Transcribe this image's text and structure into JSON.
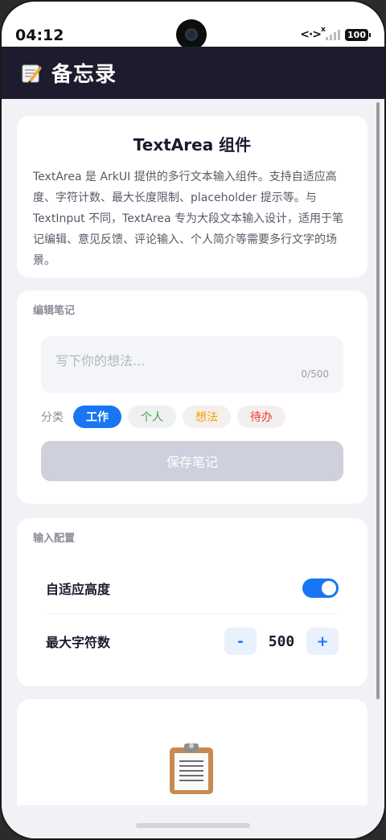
{
  "status_bar": {
    "time": "04:12",
    "network_icon": "data-transfer-icon",
    "signal_icon": "signal-icon",
    "battery": "100"
  },
  "header": {
    "icon": "memo-icon",
    "title": "备忘录"
  },
  "intro": {
    "title": "TextArea 组件",
    "description": "TextArea 是 ArkUI 提供的多行文本输入组件。支持自适应高度、字符计数、最大长度限制、placeholder 提示等。与 TextInput 不同，TextArea 专为大段文本输入设计，适用于笔记编辑、意见反馈、评论输入、个人简介等需要多行文字的场景。"
  },
  "editor": {
    "section_title": "编辑笔记",
    "placeholder": "写下你的想法...",
    "counter": "0/500",
    "category_label": "分类",
    "categories": [
      {
        "label": "工作",
        "selected": true,
        "color": "#1976F2"
      },
      {
        "label": "个人",
        "selected": false,
        "color": "#43A047"
      },
      {
        "label": "想法",
        "selected": false,
        "color": "#F59E0B"
      },
      {
        "label": "待办",
        "selected": false,
        "color": "#E53935"
      }
    ],
    "save_label": "保存笔记"
  },
  "config": {
    "section_title": "输入配置",
    "auto_height_label": "自适应高度",
    "auto_height_on": true,
    "max_chars_label": "最大字符数",
    "decrement_label": "-",
    "max_chars_value": "500",
    "increment_label": "+"
  },
  "empty_state": {
    "icon": "clipboard-icon"
  },
  "colors": {
    "header_bg": "#1C1C2E",
    "accent": "#1976F2",
    "save_disabled": "#CFD0DD"
  }
}
